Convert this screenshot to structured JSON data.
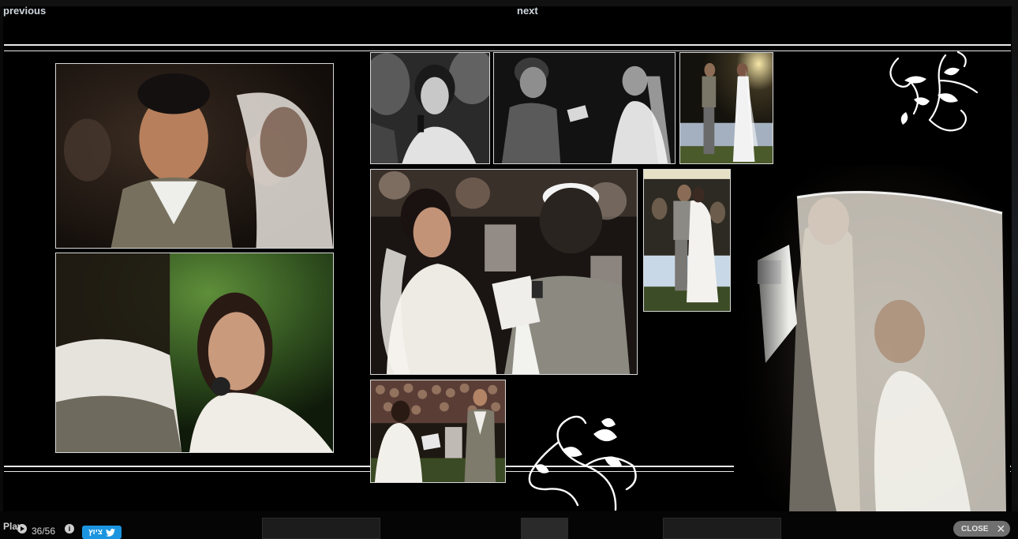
{
  "nav": {
    "previous_label": "previous",
    "next_label": "next"
  },
  "footer": {
    "play_label": "Play",
    "counter": "36/56",
    "info_icon_glyph": "i",
    "tweet_label": "ציוץ",
    "close_label": "CLOSE",
    "close_glyph": "✕"
  },
  "icons": {
    "play": "play-icon",
    "info": "info-icon",
    "tweet": "twitter-bird-icon",
    "close": "close-icon"
  },
  "colors": {
    "background": "#000000",
    "rule": "#e8e8e8",
    "tweet_button": "#1b95e0",
    "close_button": "#6f6f6f"
  }
}
